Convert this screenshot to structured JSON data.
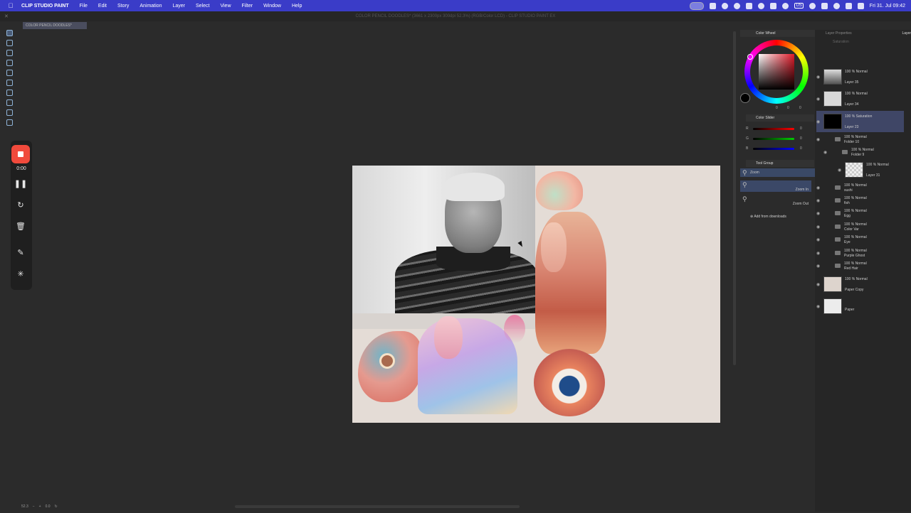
{
  "menubar": {
    "app_name": "CLIP STUDIO PAINT",
    "items": [
      "File",
      "Edit",
      "Story",
      "Animation",
      "Layer",
      "Select",
      "View",
      "Filter",
      "Window",
      "Help"
    ],
    "clock": "Fri 31. Jul  09:42",
    "keyboard": "US"
  },
  "titlebar": {
    "title": "COLOR PENCIL DOODLES* (3661 x 2300px 300dpi 52.3%) (RGB/Color LCD) - CLIP STUDIO PAINT EX"
  },
  "document_tab": "COLOR PENCIL DOODLES*",
  "recorder": {
    "time": "0:00",
    "accent": "#f04a3c"
  },
  "color_wheel": {
    "title": "Color Wheel",
    "values": [
      "0",
      "0",
      "0"
    ]
  },
  "color_slider": {
    "title": "Color Slider",
    "rows": [
      {
        "label": "R",
        "value": "0"
      },
      {
        "label": "G",
        "value": "0"
      },
      {
        "label": "B",
        "value": "0"
      }
    ]
  },
  "tool_group": {
    "title": "Tool Group",
    "selected": "Zoom",
    "zoom_in": "Zoom In",
    "zoom_out": "Zoom Out",
    "add_downloads": "Add from downloads"
  },
  "layer_panel": {
    "tabs": [
      "Layer Properties",
      "Layer"
    ],
    "blend_mode": "Saturation",
    "layers": [
      {
        "mode": "100 %  Normal",
        "name": "Layer 35"
      },
      {
        "mode": "100 %  Normal",
        "name": "Layer 34"
      },
      {
        "mode": "100 %  Saturation",
        "name": "Layer 23"
      }
    ],
    "folder10": {
      "mode": "100 %  Normal",
      "name": "Folder 10"
    },
    "folder9": {
      "mode": "100 %  Normal",
      "name": "Folder 9"
    },
    "layer31": {
      "mode": "100 %  Normal",
      "name": "Layer 31"
    },
    "folders": [
      {
        "mode": "100 %  Normal",
        "name": "sushi"
      },
      {
        "mode": "100 %  Normal",
        "name": "fish"
      },
      {
        "mode": "100 %  Normal",
        "name": "Egg"
      },
      {
        "mode": "100 %  Normal",
        "name": "Color Var"
      },
      {
        "mode": "100 %  Normal",
        "name": "Eye"
      },
      {
        "mode": "100 %  Normal",
        "name": "Purple Ghost"
      },
      {
        "mode": "100 %  Normal",
        "name": "Red Hair"
      }
    ],
    "bottom_layers": [
      {
        "mode": "100 %  Normal",
        "name": "Paper Copy"
      },
      {
        "mode": "",
        "name": "Paper"
      }
    ]
  },
  "statusbar": {
    "zoom": "52.3",
    "angle": "0.0"
  }
}
